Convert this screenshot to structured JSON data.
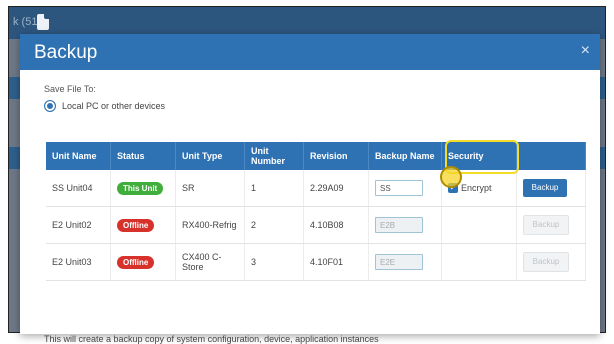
{
  "topbar": {
    "crumb": "k (51)"
  },
  "dialog": {
    "title": "Backup",
    "close_icon": "×",
    "save_file_label": "Save File To:",
    "radio_label": "Local PC or other devices",
    "footer": "This will create a backup copy of system configuration, device, application instances"
  },
  "table": {
    "headers": [
      "Unit Name",
      "Status",
      "Unit Type",
      "Unit Number",
      "Revision",
      "Backup Name",
      "Security",
      ""
    ],
    "rows": [
      {
        "name": "SS Unit04",
        "status": "This Unit",
        "status_color": "#3fae3a",
        "type": "SR",
        "number": "1",
        "revision": "2.29A09",
        "backup_name": "SS",
        "security": "Encrypt",
        "action": "Backup"
      },
      {
        "name": "E2 Unit02",
        "status": "Offline",
        "status_color": "#d6322b",
        "type": "RX400-Refrig",
        "number": "2",
        "revision": "4.10B08",
        "backup_name": "E2B",
        "action": "Backup"
      },
      {
        "name": "E2 Unit03",
        "status": "Offline",
        "status_color": "#d6322b",
        "type": "CX400 C-Store",
        "number": "3",
        "revision": "4.10F01",
        "backup_name": "E2E",
        "action": "Backup"
      }
    ]
  },
  "colors": {
    "header_blue": "#2f72b3",
    "highlight": "#f3db2a",
    "online": "#3fae3a",
    "offline": "#d6322b"
  }
}
